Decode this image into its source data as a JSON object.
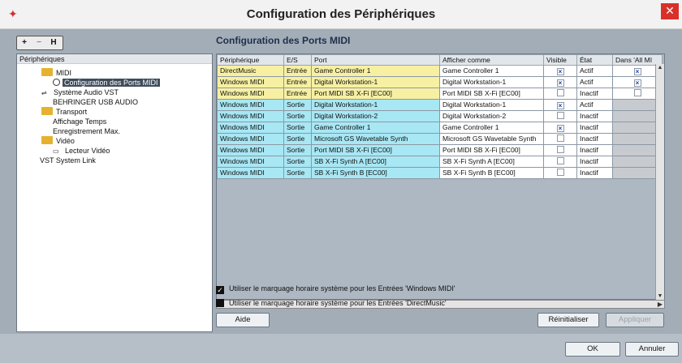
{
  "window": {
    "title": "Configuration des Périphériques",
    "close_label": "✕",
    "app_icon": "cubase-logo-icon"
  },
  "tree_toolbar": {
    "add": "+",
    "remove": "−",
    "reset": "H"
  },
  "tree": {
    "header": "Périphériques",
    "items": [
      {
        "label": "MIDI",
        "icon": "folder-icon"
      },
      {
        "label": "Configuration des Ports MIDI",
        "icon": "clock-icon"
      },
      {
        "label": "Système Audio VST",
        "icon": "audio-icon"
      },
      {
        "label": "BEHRINGER USB AUDIO",
        "icon": ""
      },
      {
        "label": "Transport",
        "icon": "folder-icon"
      },
      {
        "label": "Affichage Temps",
        "icon": ""
      },
      {
        "label": "Enregistrement Max.",
        "icon": ""
      },
      {
        "label": "Vidéo",
        "icon": "folder-icon"
      },
      {
        "label": "Lecteur Vidéo",
        "icon": "video-icon"
      },
      {
        "label": "VST System Link",
        "icon": ""
      }
    ]
  },
  "main": {
    "title": "Configuration des Ports MIDI",
    "columns": [
      "Périphérique",
      "E/S",
      "Port",
      "Afficher comme",
      "Visible",
      "État",
      "Dans 'All MI"
    ],
    "rows": [
      {
        "device": "DirectMusic",
        "io": "Entrée",
        "port": "Game Controller 1",
        "display": "Game Controller 1",
        "visible": true,
        "state": "Actif",
        "all_midi": true,
        "type": "in"
      },
      {
        "device": "Windows MIDI",
        "io": "Entrée",
        "port": "Digital Workstation-1",
        "display": "Digital Workstation-1",
        "visible": true,
        "state": "Actif",
        "all_midi": true,
        "type": "in"
      },
      {
        "device": "Windows MIDI",
        "io": "Entrée",
        "port": "Port MIDI SB X-Fi [EC00]",
        "display": "Port MIDI SB X-Fi [EC00]",
        "visible": false,
        "state": "Inactif",
        "all_midi": false,
        "type": "in"
      },
      {
        "device": "Windows MIDI",
        "io": "Sortie",
        "port": "Digital Workstation-1",
        "display": "Digital Workstation-1",
        "visible": true,
        "state": "Actif",
        "all_midi": null,
        "type": "out"
      },
      {
        "device": "Windows MIDI",
        "io": "Sortie",
        "port": "Digital Workstation-2",
        "display": "Digital Workstation-2",
        "visible": false,
        "state": "Inactif",
        "all_midi": null,
        "type": "out"
      },
      {
        "device": "Windows MIDI",
        "io": "Sortie",
        "port": "Game Controller 1",
        "display": "Game Controller 1",
        "visible": true,
        "state": "Inactif",
        "all_midi": null,
        "type": "out"
      },
      {
        "device": "Windows MIDI",
        "io": "Sortie",
        "port": "Microsoft GS Wavetable Synth",
        "display": "Microsoft GS Wavetable Synth",
        "visible": false,
        "state": "Inactif",
        "all_midi": null,
        "type": "out"
      },
      {
        "device": "Windows MIDI",
        "io": "Sortie",
        "port": "Port MIDI SB X-Fi [EC00]",
        "display": "Port MIDI SB X-Fi [EC00]",
        "visible": false,
        "state": "Inactif",
        "all_midi": null,
        "type": "out"
      },
      {
        "device": "Windows MIDI",
        "io": "Sortie",
        "port": "SB X-Fi Synth A [EC00]",
        "display": "SB X-Fi Synth A [EC00]",
        "visible": false,
        "state": "Inactif",
        "all_midi": null,
        "type": "out"
      },
      {
        "device": "Windows MIDI",
        "io": "Sortie",
        "port": "SB X-Fi Synth B [EC00]",
        "display": "SB X-Fi Synth B [EC00]",
        "visible": false,
        "state": "Inactif",
        "all_midi": null,
        "type": "out"
      }
    ],
    "options": [
      {
        "label": "Utiliser le marquage horaire système pour les Entrées 'Windows MIDI'",
        "checked": true
      },
      {
        "label": "Utiliser le marquage horaire système pour les Entrées 'DirectMusic'",
        "checked": false
      }
    ],
    "buttons": {
      "help": "Aide",
      "reset": "Réinitialiser",
      "apply": "Appliquer"
    }
  },
  "footer": {
    "ok": "OK",
    "cancel": "Annuler"
  },
  "colors": {
    "input_row": "#f7f0a2",
    "output_row": "#a8e7f4",
    "selected": "#3f4d5b",
    "close": "#d9302a"
  }
}
